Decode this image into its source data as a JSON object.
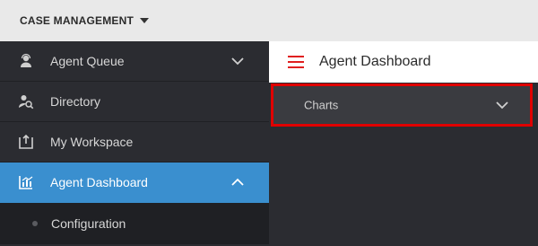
{
  "topbar": {
    "app_title": "CASE MANAGEMENT"
  },
  "sidebar": {
    "items": [
      {
        "label": "Agent Queue",
        "icon": "agent-queue-icon"
      },
      {
        "label": "Directory",
        "icon": "directory-icon"
      },
      {
        "label": "My Workspace",
        "icon": "workspace-icon"
      },
      {
        "label": "Agent Dashboard",
        "icon": "dashboard-chart-icon"
      }
    ],
    "sub_items": [
      {
        "label": "Configuration"
      }
    ]
  },
  "main": {
    "title": "Agent Dashboard",
    "charts_label": "Charts"
  },
  "colors": {
    "active": "#3a8fcf",
    "highlight_border": "#e00000",
    "menu_icon": "#e02020",
    "sidebar_bg": "#2b2c31"
  }
}
